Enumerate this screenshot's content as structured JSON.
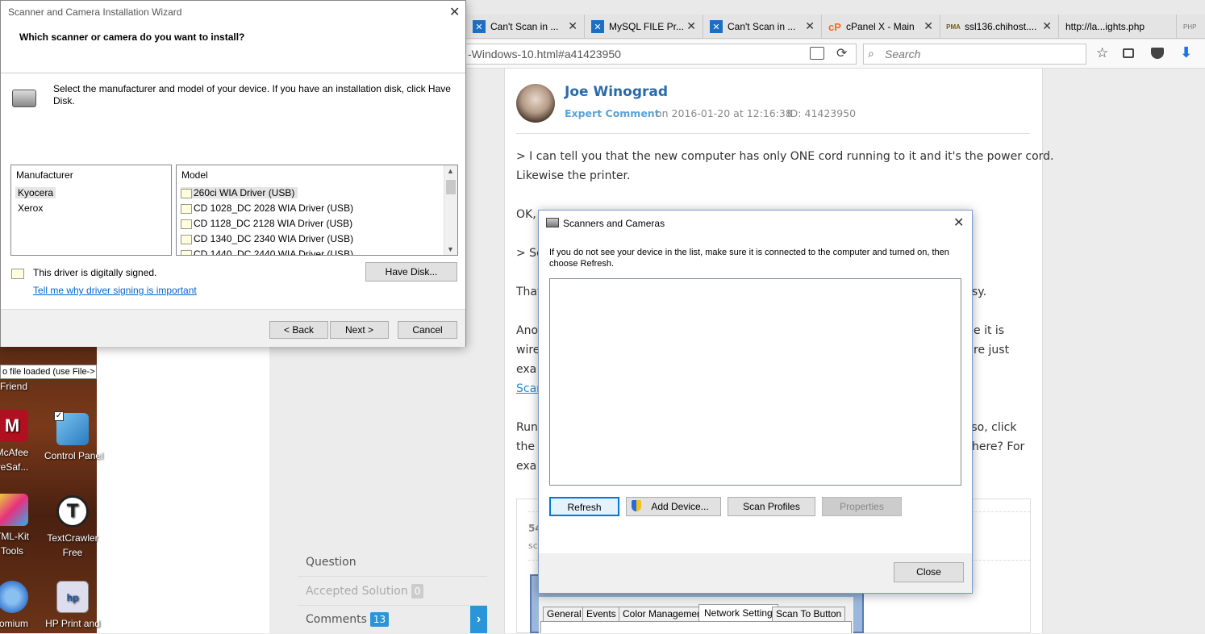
{
  "wizard": {
    "title": "Scanner and Camera Installation Wizard",
    "heading": "Which scanner or camera do you want to install?",
    "instruction": "Select the manufacturer and model of your device. If you have an installation disk, click Have Disk.",
    "manufacturer_header": "Manufacturer",
    "manufacturers": [
      "Kyocera",
      "Xerox"
    ],
    "model_header": "Model",
    "models": [
      "260ci WIA Driver (USB)",
      "CD 1028_DC 2028 WIA Driver (USB)",
      "CD 1128_DC 2128 WIA Driver (USB)",
      "CD 1340_DC 2340 WIA Driver (USB)",
      "CD 1440_DC 2440 WIA Driver (USB)"
    ],
    "signed_text": "This driver is digitally signed.",
    "signing_link": "Tell me why driver signing is important",
    "have_disk": "Have Disk...",
    "back": "< Back",
    "next": "Next >",
    "cancel": "Cancel"
  },
  "desktop": {
    "notice": "o file loaded (use File->",
    "friend": "Friend",
    "icons": [
      {
        "label1": "McAfee",
        "label2": "veSaf...",
        "icon": "mcafee-icon"
      },
      {
        "label1": "Control Panel",
        "label2": "",
        "icon": "control-panel-icon"
      },
      {
        "label1": "TML-Kit",
        "label2": "Tools",
        "icon": "html-kit-icon"
      },
      {
        "label1": "TextCrawler",
        "label2": "Free",
        "icon": "textcrawler-icon"
      },
      {
        "label1": "romium",
        "label2": "",
        "icon": "chromium-icon"
      },
      {
        "label1": "HP Print and",
        "label2": "",
        "icon": "hp-print-icon"
      }
    ]
  },
  "browser": {
    "tabs": [
      {
        "label": "Can't Scan in ...",
        "icon": "x-icon"
      },
      {
        "label": "MySQL FILE Pr...",
        "icon": "x-icon"
      },
      {
        "label": "Can't Scan in ...",
        "icon": "x-icon"
      },
      {
        "label": "cPanel X - Main",
        "icon": "cpanel-icon"
      },
      {
        "label": "ssl136.chihost....",
        "icon": "pma-icon"
      },
      {
        "label": "http://la...ights.php",
        "icon": ""
      }
    ],
    "url": "-Windows-10.html#a41423950",
    "search_placeholder": "Search"
  },
  "comment": {
    "author": "Joe Winograd",
    "role": "Expert Comment",
    "date": "on 2016-01-20 at 12:16:38",
    "id": "ID: 41423950",
    "lines": [
      "> I can tell you that the new computer has only ONE cord running to it and it's the power cord.",
      "Likewise the printer.",
      "OK,",
      "> So",
      "That",
      "sy.",
      "Ano",
      "e it is",
      "wire",
      "re just",
      "exa",
      "Scan",
      "Run",
      "f so, click",
      "the l",
      "here? For",
      "exa"
    ],
    "nested_num": "54",
    "nested_text": "sc"
  },
  "sidebar": {
    "question": "Question",
    "accepted": "Accepted Solution",
    "accepted_count": "0",
    "comments": "Comments",
    "comments_count": "13"
  },
  "scanners": {
    "title": "Scanners and Cameras",
    "message": "If you do not see your device in the list, make sure it is connected to the computer and turned on, then choose Refresh.",
    "refresh": "Refresh",
    "add_device": "Add Device...",
    "scan_profiles": "Scan Profiles",
    "properties": "Properties",
    "close": "Close"
  },
  "embedded_tabs": [
    "General",
    "Events",
    "Color Management",
    "Network Setting",
    "Scan To Button"
  ]
}
